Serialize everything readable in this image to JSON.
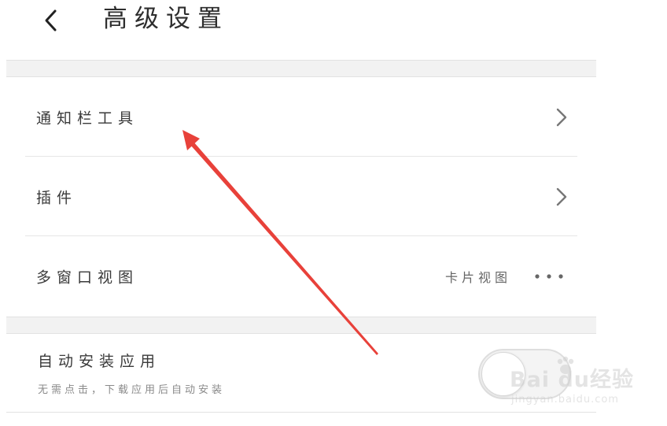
{
  "header": {
    "back_icon": "chevron-left-icon",
    "title": "高级设置"
  },
  "settings": {
    "notification_tools": {
      "label": "通知栏工具",
      "icon": "chevron-right-icon"
    },
    "plugins": {
      "label": "插件",
      "icon": "chevron-right-icon"
    },
    "multi_window": {
      "label": "多窗口视图",
      "value": "卡片视图",
      "icon": "more-dots-icon"
    },
    "auto_install": {
      "label": "自动安装应用",
      "description": "无需点击，下载应用后自动安装",
      "toggle_on": false
    }
  },
  "annotation": {
    "arrow_color": "#e8413a"
  },
  "watermark": {
    "logo": "Bai du经验",
    "url": "jingyan.baidu.com"
  }
}
